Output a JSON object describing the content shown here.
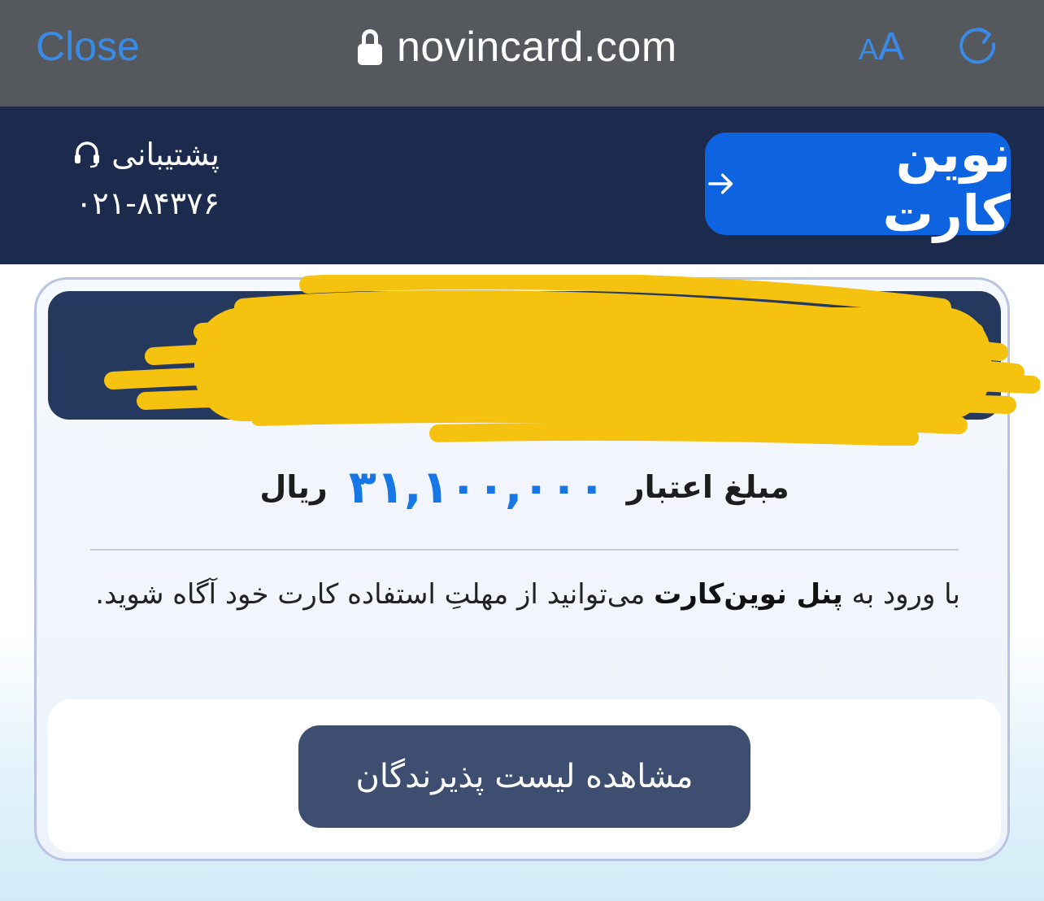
{
  "browser": {
    "close_label": "Close",
    "url": "novincard.com",
    "text_size_small": "A",
    "text_size_big": "A"
  },
  "header": {
    "logo_text": "نوین کارت",
    "support_label": "پشتیبانی",
    "support_phone": "۰۲۱-۸۴۳۷۶"
  },
  "card": {
    "credit_label": "مبلغ اعتبار",
    "credit_amount": "۳۱,۱۰۰,۰۰۰",
    "credit_unit": "ریال",
    "info_part1": "با ورود به ",
    "info_bold": "پنل نوین‌کارت",
    "info_part2": " می‌توانید از مهلتِ استفاده کارت خود آگاه شوید.",
    "merchants_button": "مشاهده لیست پذیرندگان"
  },
  "colors": {
    "browser_bar": "#55585d",
    "accent_link": "#3a8be8",
    "header_bg": "#1c2b4d",
    "logo_bg": "#0e63e0",
    "amount": "#1877e6",
    "redaction": "#f5c20f",
    "button_bg": "#3e4e70"
  }
}
